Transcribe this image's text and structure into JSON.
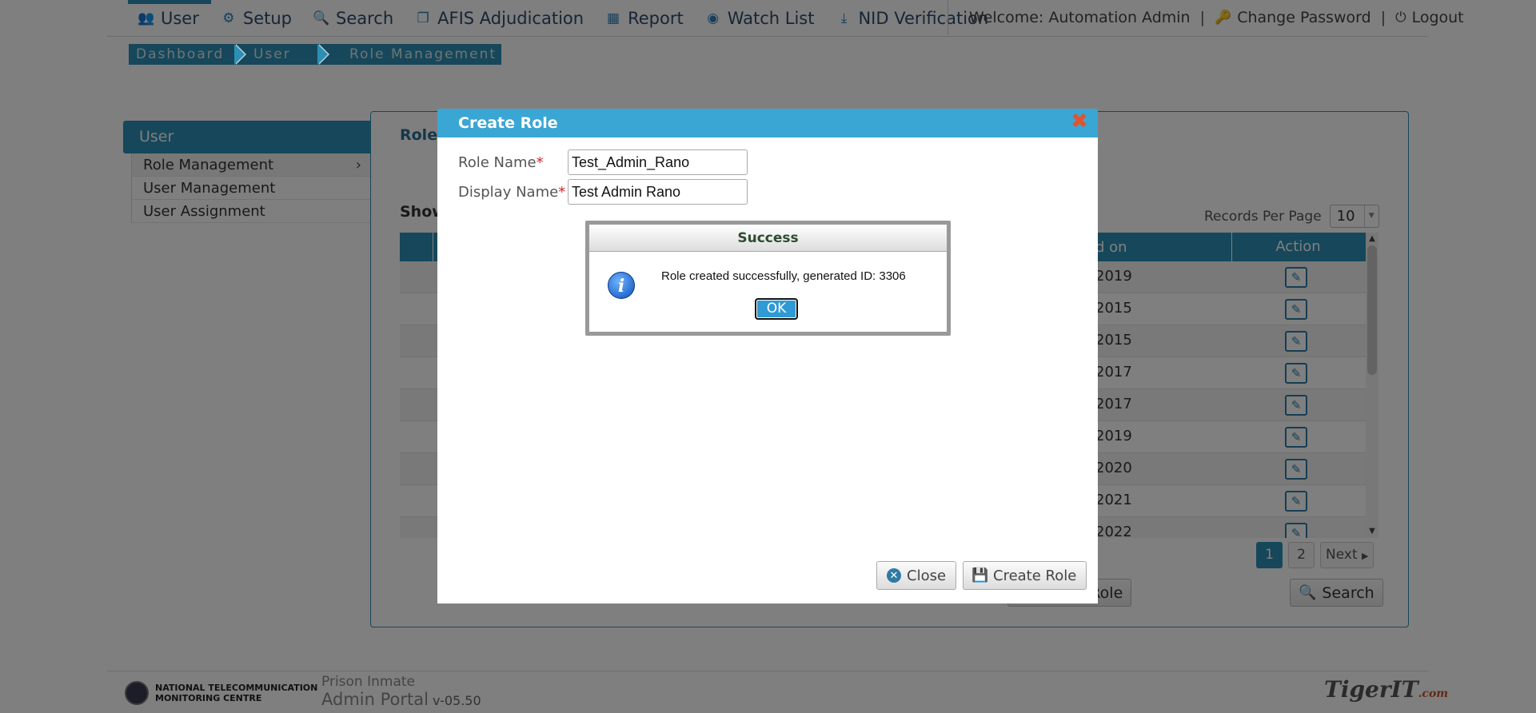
{
  "nav": {
    "items": [
      {
        "label": "User",
        "icon": "users-icon"
      },
      {
        "label": "Setup",
        "icon": "gear-icon"
      },
      {
        "label": "Search",
        "icon": "search-icon"
      },
      {
        "label": "AFIS Adjudication",
        "icon": "copy-icon"
      },
      {
        "label": "Report",
        "icon": "bar-chart-icon"
      },
      {
        "label": "Watch List",
        "icon": "eye-icon"
      },
      {
        "label": "NID Verification",
        "icon": "download-icon"
      }
    ],
    "welcome": "Welcome: Automation Admin",
    "separator": "|",
    "change_password": "Change Password",
    "logout": "Logout"
  },
  "breadcrumb": [
    "Dashboard",
    "User",
    "Role Management"
  ],
  "sidebar": {
    "heading": "User",
    "items": [
      "Role Management",
      "User Management",
      "User Assignment"
    ],
    "active_chevron": "›"
  },
  "panel": {
    "title": "Role",
    "show_label": "Show",
    "records_per_page_label": "Records Per Page",
    "records_per_page_value": "10",
    "table": {
      "date_header": "d on",
      "action_header": "Action",
      "rows": [
        "2019",
        "2015",
        "2015",
        "2017",
        "2017",
        "2019",
        "2020",
        "2021",
        "2022"
      ]
    },
    "pager": {
      "pages": [
        "1",
        "2"
      ],
      "next": "Next"
    },
    "create_role_button": "Create Role",
    "search_button": "Search"
  },
  "dialog": {
    "title": "Create Role",
    "role_name_label": "Role Name",
    "role_name_value": "Test_Admin_Rano",
    "display_name_label": "Display Name",
    "display_name_value": "Test Admin Rano",
    "required_mark": "*",
    "close_button": "Close",
    "create_button": "Create Role"
  },
  "alert": {
    "title": "Success",
    "message": "Role created successfully, generated ID: 3306",
    "ok": "OK"
  },
  "footer": {
    "org_line1": "NATIONAL TELECOMMUNICATION",
    "org_line2": "MONITORING CENTRE",
    "app_line1": "Prison Inmate",
    "app_line2": "Admin Portal",
    "version": "v-05.50",
    "vendor": "TigerIT",
    "vendor_suffix": ".com"
  },
  "colors": {
    "primary": "#2e8fb5",
    "dialog_title": "#3aa6d4",
    "overlay": "rgba(0,0,0,0.5)"
  }
}
